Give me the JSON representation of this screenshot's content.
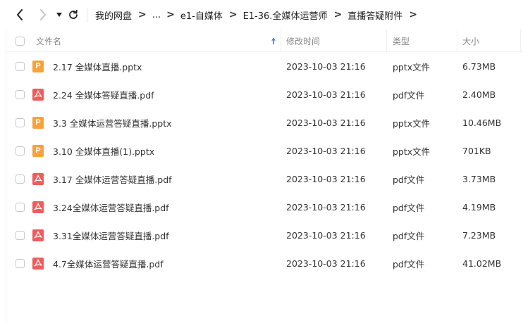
{
  "nav": {
    "back_icon": "chevron-left-icon",
    "forward_icon": "chevron-right-icon",
    "dropdown_icon": "caret-down-icon",
    "refresh_icon": "refresh-icon"
  },
  "breadcrumb": {
    "items": [
      "我的网盘",
      "...",
      "e1-自媒体",
      "E1-36.全媒体运营师",
      "直播答疑附件"
    ],
    "separator": ">"
  },
  "table": {
    "columns": {
      "name": "文件名",
      "modified": "修改时间",
      "type": "类型",
      "size": "大小"
    },
    "sort_icon": "sort-asc-arrow-icon",
    "rows": [
      {
        "name": "2.17 全媒体直播.pptx",
        "modified": "2023-10-03 21:16",
        "type": "pptx文件",
        "size": "6.73MB",
        "icon": "pptx-file-icon",
        "icon_glyph": "P"
      },
      {
        "name": "2.24 全媒体答疑直播.pdf",
        "modified": "2023-10-03 21:16",
        "type": "pdf文件",
        "size": "2.40MB",
        "icon": "pdf-file-icon",
        "icon_glyph": ""
      },
      {
        "name": "3.3 全媒体运营答疑直播.pptx",
        "modified": "2023-10-03 21:16",
        "type": "pptx文件",
        "size": "10.46MB",
        "icon": "pptx-file-icon",
        "icon_glyph": "P"
      },
      {
        "name": "3.10 全媒体直播(1).pptx",
        "modified": "2023-10-03 21:16",
        "type": "pptx文件",
        "size": "701KB",
        "icon": "pptx-file-icon",
        "icon_glyph": "P"
      },
      {
        "name": "3.17 全媒体运营答疑直播.pdf",
        "modified": "2023-10-03 21:16",
        "type": "pdf文件",
        "size": "3.73MB",
        "icon": "pdf-file-icon",
        "icon_glyph": ""
      },
      {
        "name": "3.24全媒体运营答疑直播.pdf",
        "modified": "2023-10-03 21:16",
        "type": "pdf文件",
        "size": "4.19MB",
        "icon": "pdf-file-icon",
        "icon_glyph": ""
      },
      {
        "name": "3.31全媒体运营答疑直播.pdf",
        "modified": "2023-10-03 21:16",
        "type": "pdf文件",
        "size": "7.23MB",
        "icon": "pdf-file-icon",
        "icon_glyph": ""
      },
      {
        "name": "4.7全媒体运营答疑直播.pdf",
        "modified": "2023-10-03 21:16",
        "type": "pdf文件",
        "size": "41.02MB",
        "icon": "pdf-file-icon",
        "icon_glyph": ""
      }
    ]
  },
  "colors": {
    "pptx": "#f7a23a",
    "pdf": "#f15b5b",
    "sort_arrow": "#2f7cf6"
  }
}
